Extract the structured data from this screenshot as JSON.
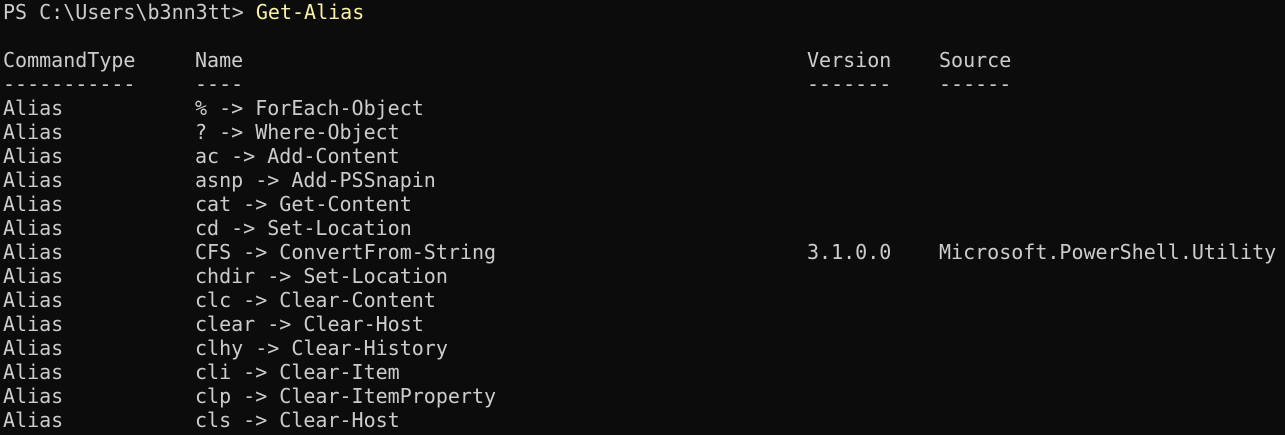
{
  "prompt": {
    "text": "PS C:\\Users\\b3nn3tt> ",
    "command": "Get-Alias"
  },
  "table": {
    "headers": {
      "type": "CommandType",
      "name": "Name",
      "version": "Version",
      "source": "Source"
    },
    "underlines": {
      "type": "-----------",
      "name": "----",
      "version": "-------",
      "source": "------"
    },
    "rows": [
      {
        "type": "Alias",
        "name": "% -> ForEach-Object",
        "version": "",
        "source": ""
      },
      {
        "type": "Alias",
        "name": "? -> Where-Object",
        "version": "",
        "source": ""
      },
      {
        "type": "Alias",
        "name": "ac -> Add-Content",
        "version": "",
        "source": ""
      },
      {
        "type": "Alias",
        "name": "asnp -> Add-PSSnapin",
        "version": "",
        "source": ""
      },
      {
        "type": "Alias",
        "name": "cat -> Get-Content",
        "version": "",
        "source": ""
      },
      {
        "type": "Alias",
        "name": "cd -> Set-Location",
        "version": "",
        "source": ""
      },
      {
        "type": "Alias",
        "name": "CFS -> ConvertFrom-String",
        "version": "3.1.0.0",
        "source": "Microsoft.PowerShell.Utility"
      },
      {
        "type": "Alias",
        "name": "chdir -> Set-Location",
        "version": "",
        "source": ""
      },
      {
        "type": "Alias",
        "name": "clc -> Clear-Content",
        "version": "",
        "source": ""
      },
      {
        "type": "Alias",
        "name": "clear -> Clear-Host",
        "version": "",
        "source": ""
      },
      {
        "type": "Alias",
        "name": "clhy -> Clear-History",
        "version": "",
        "source": ""
      },
      {
        "type": "Alias",
        "name": "cli -> Clear-Item",
        "version": "",
        "source": ""
      },
      {
        "type": "Alias",
        "name": "clp -> Clear-ItemProperty",
        "version": "",
        "source": ""
      },
      {
        "type": "Alias",
        "name": "cls -> Clear-Host",
        "version": "",
        "source": ""
      }
    ]
  },
  "colors": {
    "background": "#0c0c0c",
    "foreground": "#cccccc",
    "command": "#f9f1a5"
  }
}
